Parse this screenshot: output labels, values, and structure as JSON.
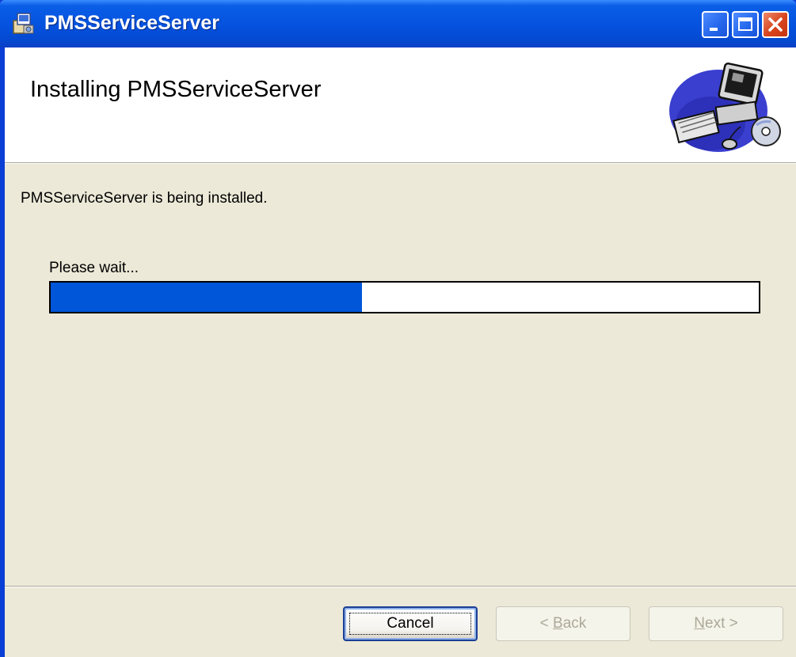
{
  "window": {
    "title": "PMSServiceServer"
  },
  "banner": {
    "title": "Installing PMSServiceServer",
    "graphic": "computer-with-cd-icon"
  },
  "body": {
    "status": "PMSServiceServer is being installed.",
    "wait_label": "Please wait...",
    "progress_percent": 44
  },
  "buttons": {
    "cancel": "Cancel",
    "back_prefix": "< ",
    "back_accel": "B",
    "back_rest": "ack",
    "next_accel": "N",
    "next_rest": "ext >"
  },
  "colors": {
    "titlebar": "#0553e0",
    "progress_fill": "#0056d8",
    "dialog_bg": "#ece9d8",
    "close_button": "#d8431c"
  },
  "icons": {
    "title": "installer-package-icon",
    "minimize": "minimize-icon",
    "maximize": "maximize-icon",
    "close": "close-icon"
  }
}
